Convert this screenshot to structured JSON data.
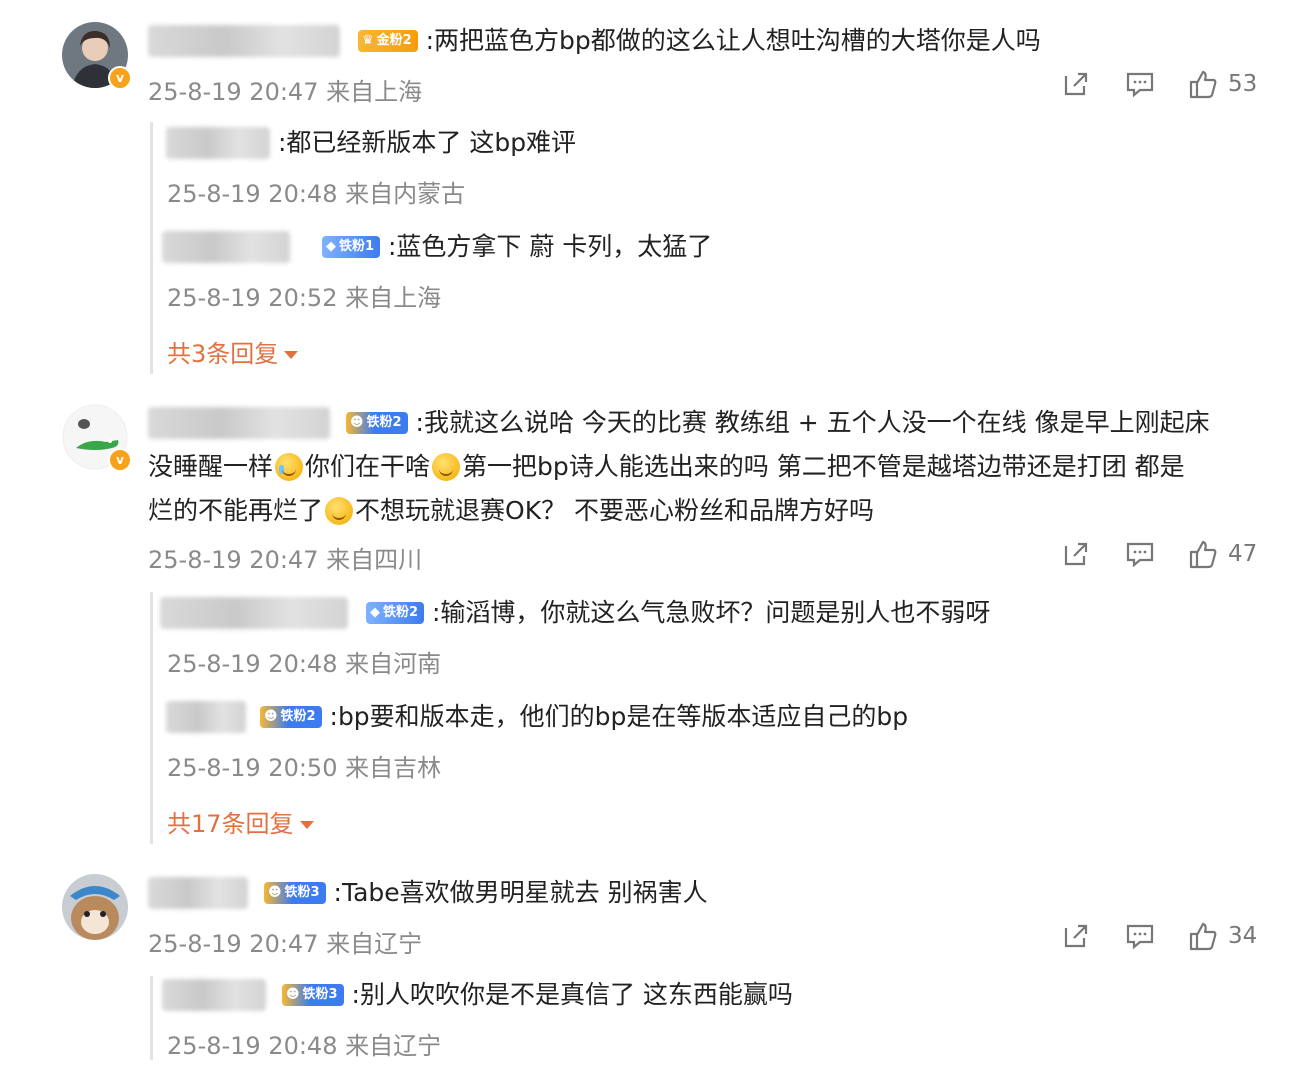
{
  "comments": [
    {
      "badge": "金粉2",
      "text": ":两把蓝色方bp都做的这么让人想吐沟槽的大塔你是人吗",
      "meta": "25-8-19 20:47 来自上海",
      "likes": "53",
      "replies": [
        {
          "text": ":都已经新版本了  这bp难评",
          "meta": "25-8-19 20:48 来自内蒙古"
        },
        {
          "badge": "铁粉1",
          "text": ":蓝色方拿下 蔚 卡列，太猛了",
          "meta": "25-8-19 20:52 来自上海"
        }
      ],
      "more": "共3条回复"
    },
    {
      "badge": "铁粉2",
      "text_line1": ":我就这么说哈 今天的比赛 教练组 + 五个人没一个在线 像是早上刚起床",
      "text_line2a": "没睡醒一样",
      "text_line2b": "你们在干啥",
      "text_line2c": "第一把bp诗人能选出来的吗 第二把不管是越塔边带还是打团 都是",
      "text_line3a": "烂的不能再烂了",
      "text_line3b": "不想玩就退赛OK？ 不要恶心粉丝和品牌方好吗",
      "meta": "25-8-19 20:47 来自四川",
      "likes": "47",
      "replies": [
        {
          "badge": "铁粉2",
          "text": ":输滔博，你就这么气急败坏？问题是别人也不弱呀",
          "meta": "25-8-19 20:48 来自河南"
        },
        {
          "badge": "铁粉2",
          "text": ":bp要和版本走，他们的bp是在等版本适应自己的bp",
          "meta": "25-8-19 20:50 来自吉林"
        }
      ],
      "more": "共17条回复"
    },
    {
      "badge": "铁粉3",
      "text": ":Tabe喜欢做男明星就去 别祸害人",
      "meta": "25-8-19 20:47 来自辽宁",
      "likes": "34",
      "replies": [
        {
          "badge": "铁粉3",
          "text": ":别人吹吹你是不是真信了 这东西能赢吗",
          "meta": "25-8-19 20:48 来自辽宁"
        }
      ]
    }
  ],
  "icons": {
    "share": "share-icon",
    "comment": "comment-icon",
    "like": "thumbs-up-icon",
    "verified": "verified-badge-icon"
  },
  "colors": {
    "more_link": "#e3703f",
    "meta_text": "#8a8a8a",
    "gold_badge": "#f59e0b",
    "iron_badge": "#3d7cf0"
  }
}
